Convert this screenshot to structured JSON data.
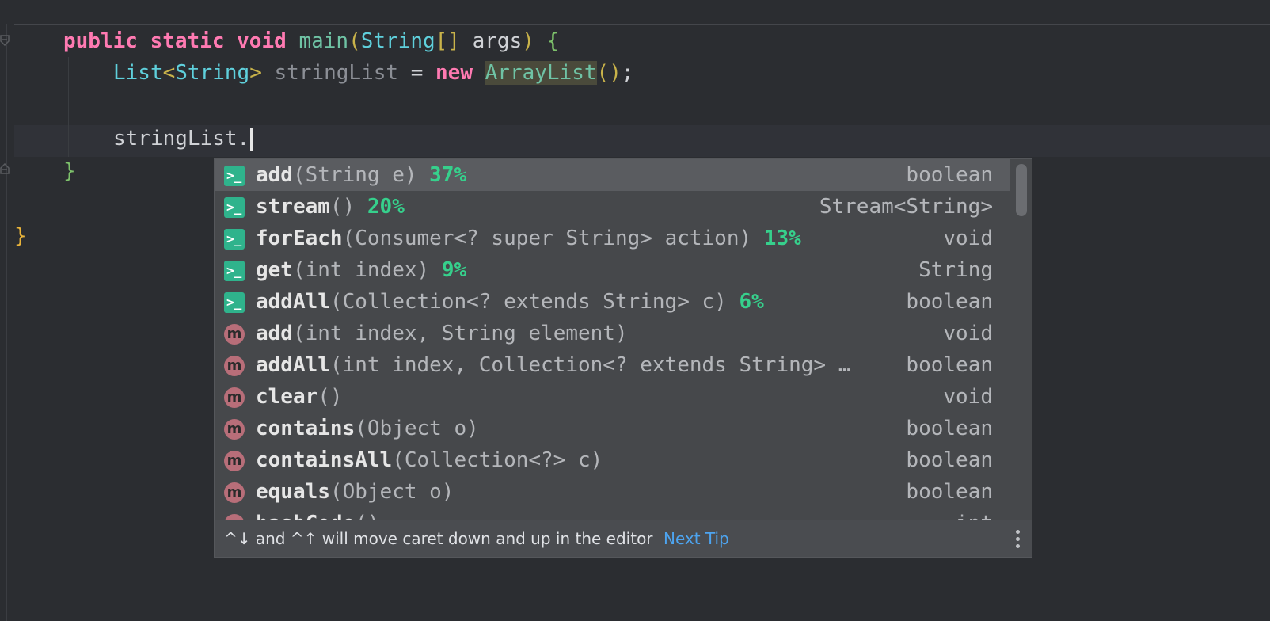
{
  "editor": {
    "line1": {
      "kw1": "public",
      "kw2": "static",
      "kw3": "void",
      "fn": "main",
      "p_open": "(",
      "type": "String",
      "arr": "[]",
      "arg": "args",
      "p_close": ")",
      "brace": "{"
    },
    "line2": {
      "type1": "List",
      "lt": "<",
      "type2": "String",
      "gt": ">",
      "var": "stringList",
      "eq": "=",
      "kw": "new",
      "ctor": "ArrayList",
      "paren": "()",
      "semi": ";"
    },
    "line4": {
      "text": "stringList."
    },
    "line5": {
      "brace": "}"
    },
    "line7": {
      "brace": "}"
    }
  },
  "completion": {
    "items": [
      {
        "icon": "ai-ranked-method-icon",
        "name": "add",
        "params": "(String e)",
        "pct": "37%",
        "ret": "boolean",
        "selected": true
      },
      {
        "icon": "ai-ranked-method-icon",
        "name": "stream",
        "params": "()",
        "pct": "20%",
        "ret": "Stream<String>"
      },
      {
        "icon": "ai-ranked-method-icon",
        "name": "forEach",
        "params": "(Consumer<? super String> action)",
        "pct": "13%",
        "ret": "void"
      },
      {
        "icon": "ai-ranked-method-icon",
        "name": "get",
        "params": "(int index)",
        "pct": "9%",
        "ret": "String"
      },
      {
        "icon": "ai-ranked-method-icon",
        "name": "addAll",
        "params": "(Collection<? extends String> c)",
        "pct": "6%",
        "ret": "boolean"
      },
      {
        "icon": "method-icon",
        "name": "add",
        "params": "(int index, String element)",
        "pct": "",
        "ret": "void"
      },
      {
        "icon": "method-icon",
        "name": "addAll",
        "params": "(int index, Collection<? extends String> …",
        "pct": "",
        "ret": "boolean"
      },
      {
        "icon": "method-icon",
        "name": "clear",
        "params": "()",
        "pct": "",
        "ret": "void"
      },
      {
        "icon": "method-icon",
        "name": "contains",
        "params": "(Object o)",
        "pct": "",
        "ret": "boolean"
      },
      {
        "icon": "method-icon",
        "name": "containsAll",
        "params": "(Collection<?> c)",
        "pct": "",
        "ret": "boolean"
      },
      {
        "icon": "method-icon",
        "name": "equals",
        "params": "(Object o)",
        "pct": "",
        "ret": "boolean"
      },
      {
        "icon": "method-icon",
        "name": "hashCode",
        "params": "()",
        "pct": "",
        "ret": "int"
      }
    ],
    "icon_glyphs": {
      "ai": ">_",
      "method": "m"
    },
    "footer": {
      "tip": "^↓ and ^↑ will move caret down and up in the editor",
      "next_tip": "Next Tip"
    }
  },
  "colors": {
    "keyword": "#ff7ab2",
    "function": "#6fc3a5",
    "type": "#5fd0dc",
    "percent": "#36d08c",
    "link": "#4da4f0",
    "background": "#2b2d31"
  }
}
